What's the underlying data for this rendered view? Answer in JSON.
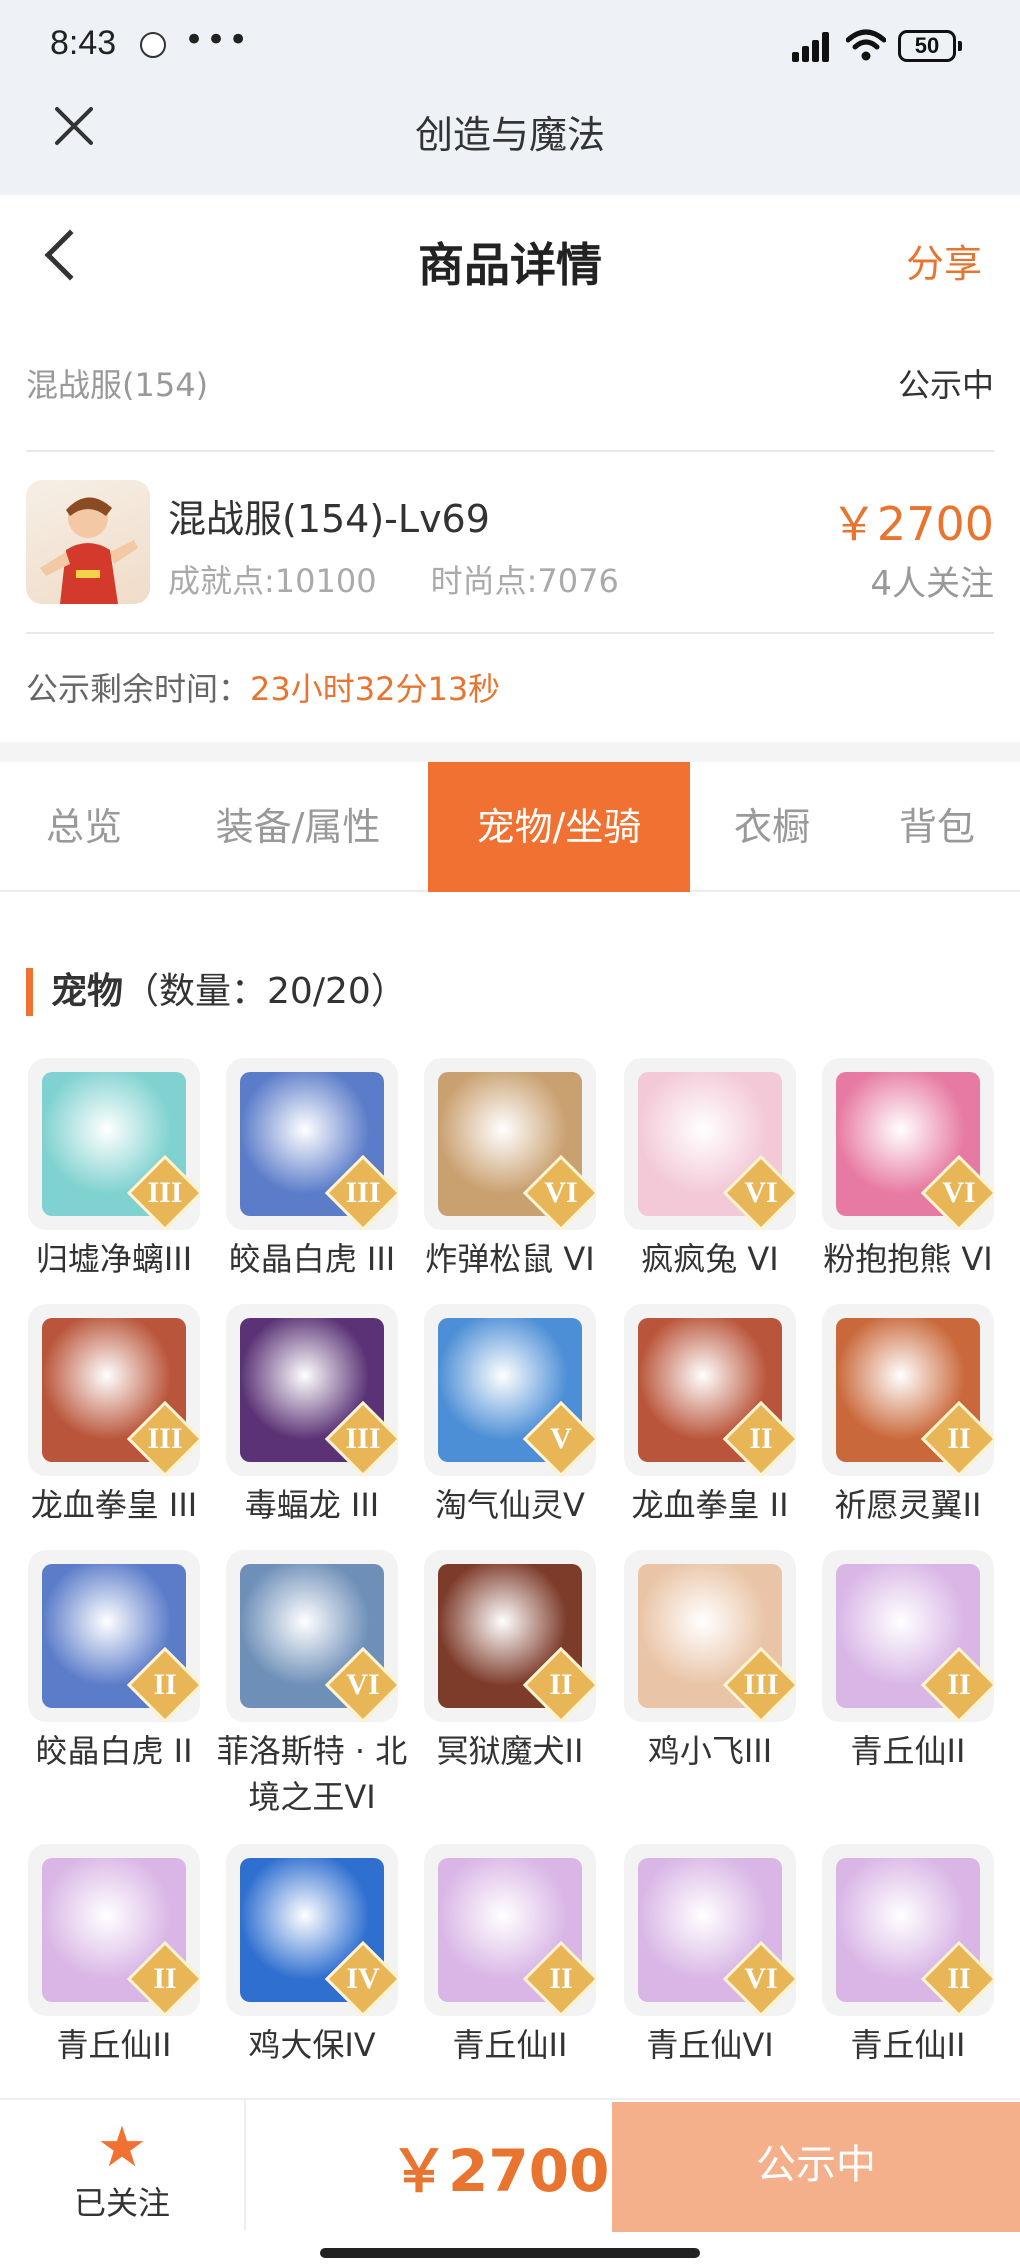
{
  "status_bar": {
    "time": "8:43",
    "dots": "•••",
    "battery": "50"
  },
  "app": {
    "title": "创造与魔法"
  },
  "nav": {
    "title": "商品详情",
    "share_label": "分享"
  },
  "product": {
    "server": "混战服(154)",
    "listing_status": "公示中",
    "name": "混战服(154)-Lv69",
    "achievement_points": "成就点:10100",
    "fashion_points": "时尚点:7076",
    "price": "￥2700",
    "followers": "4人关注",
    "countdown_label": "公示剩余时间：",
    "countdown_value": "23小时32分13秒"
  },
  "tabs": [
    {
      "label": "总览",
      "active": false
    },
    {
      "label": "装备/属性",
      "active": false
    },
    {
      "label": "宠物/坐骑",
      "active": true
    },
    {
      "label": "衣橱",
      "active": false
    },
    {
      "label": "背包",
      "active": false
    }
  ],
  "pets_section": {
    "title": "宠物",
    "count_label": "（数量：20/20）"
  },
  "pets": [
    {
      "name": "归墟净螭III",
      "rank": "III",
      "color": "#7fd2d0"
    },
    {
      "name": "皎晶白虎 III",
      "rank": "III",
      "color": "#5b7cc9"
    },
    {
      "name": "炸弹松鼠 VI",
      "rank": "VI",
      "color": "#c9a070"
    },
    {
      "name": "疯疯兔 VI",
      "rank": "VI",
      "color": "#f3c9d8"
    },
    {
      "name": "粉抱抱熊 VI",
      "rank": "VI",
      "color": "#e77aa2"
    },
    {
      "name": "龙血拳皇 III",
      "rank": "III",
      "color": "#b9553a"
    },
    {
      "name": "毒蝠龙 III",
      "rank": "III",
      "color": "#5a3275"
    },
    {
      "name": "淘气仙灵V",
      "rank": "V",
      "color": "#4d8fd6"
    },
    {
      "name": "龙血拳皇 II",
      "rank": "II",
      "color": "#b9553a"
    },
    {
      "name": "祈愿灵翼II",
      "rank": "II",
      "color": "#c9683a"
    },
    {
      "name": "皎晶白虎 II",
      "rank": "II",
      "color": "#5b7cc9"
    },
    {
      "name": "菲洛斯特 · 北境之王VI",
      "rank": "VI",
      "color": "#6e8fb8"
    },
    {
      "name": "冥狱魔犬II",
      "rank": "II",
      "color": "#7d3b2a"
    },
    {
      "name": "鸡小飞III",
      "rank": "III",
      "color": "#e9c4a6"
    },
    {
      "name": "青丘仙II",
      "rank": "II",
      "color": "#d9b6e6"
    },
    {
      "name": "青丘仙II",
      "rank": "II",
      "color": "#d9b6e6"
    },
    {
      "name": "鸡大保IV",
      "rank": "IV",
      "color": "#2f6fd0"
    },
    {
      "name": "青丘仙II",
      "rank": "II",
      "color": "#d9b6e6"
    },
    {
      "name": "青丘仙VI",
      "rank": "VI",
      "color": "#d9b6e6"
    },
    {
      "name": "青丘仙II",
      "rank": "II",
      "color": "#d9b6e6"
    }
  ],
  "bottom_bar": {
    "follow_label": "已关注",
    "price": "￥2700",
    "cta_label": "公示中"
  },
  "colors": {
    "accent": "#f07131",
    "price": "#e8742f",
    "cta_disabled": "#f4b08a"
  }
}
